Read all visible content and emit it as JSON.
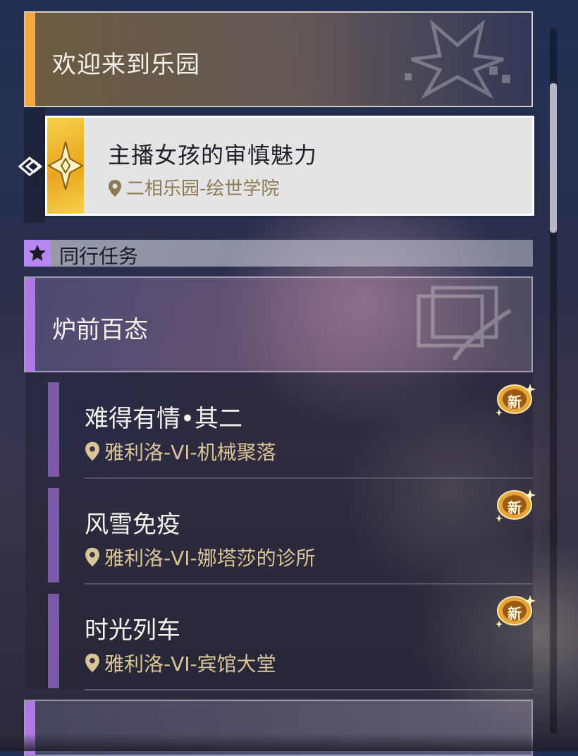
{
  "main_mission": {
    "title": "欢迎来到乐园"
  },
  "selected_quest": {
    "title": "主播女孩的审慎魅力",
    "location": "二相乐园-绘世学院"
  },
  "companion_section": {
    "label": "同行任务"
  },
  "group": {
    "title": "炉前百态",
    "quests": [
      {
        "title": "难得有情•其二",
        "location": "雅利洛-VI-机械聚落",
        "badge": "新"
      },
      {
        "title": "风雪免疫",
        "location": "雅利洛-VI-娜塔莎的诊所",
        "badge": "新"
      },
      {
        "title": "时光列车",
        "location": "雅利洛-VI-宾馆大堂",
        "badge": "新"
      }
    ]
  },
  "next_group": {
    "title": ""
  },
  "colors": {
    "main_accent": "#f2a93b",
    "companion_accent": "#b07ae6",
    "location_text": "#d8c69a",
    "new_badge": "#e8a63a"
  }
}
